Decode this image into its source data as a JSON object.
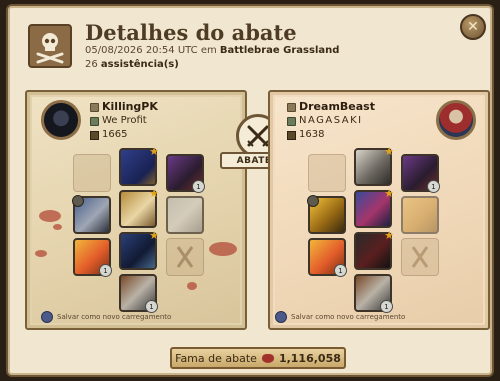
{
  "header": {
    "title": "Detalhes do abate",
    "datetime": "05/08/2026 20:54 UTC em",
    "location": "Battlebrae Grassland",
    "assist_count": "26",
    "assist_label": "assistência(s)"
  },
  "killer": {
    "name": "KillingPK",
    "guild": "We Profit",
    "item_power": "1665",
    "save_label": "Salvar como novo carregamento"
  },
  "victim": {
    "name": "DreamBeast",
    "guild": "NAGASAKI",
    "item_power": "1638",
    "save_label": "Salvar como novo carregamento"
  },
  "center": {
    "verdict": "ABATEU"
  },
  "footer": {
    "fame_label": "Fama de abate",
    "fame_value": "1,116,058"
  },
  "icons": {
    "close": "close-icon",
    "skull": "skull-crossbones-icon",
    "swords": "crossed-swords-icon",
    "fame": "blood-gem-icon"
  }
}
